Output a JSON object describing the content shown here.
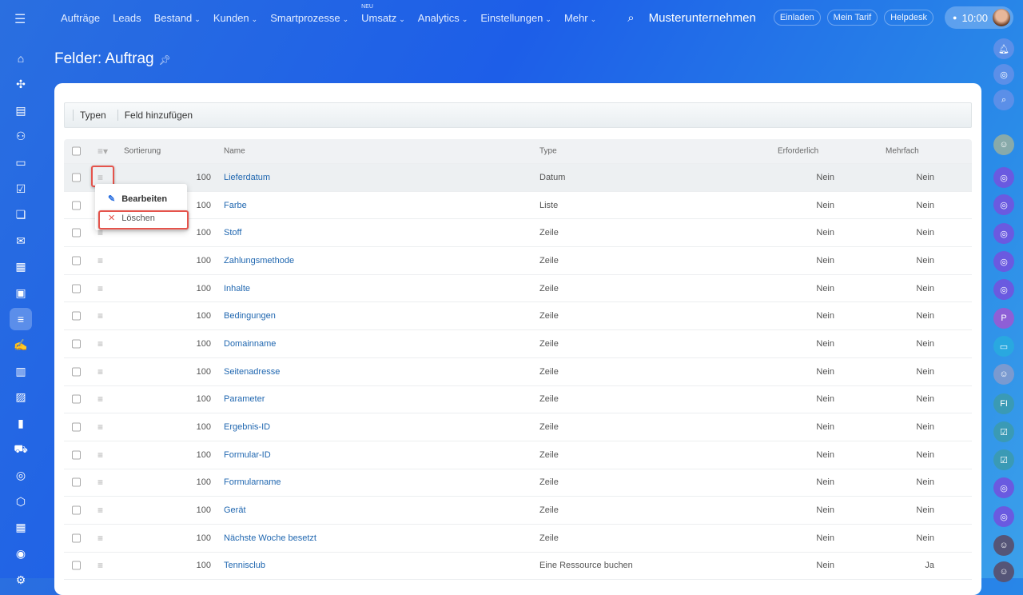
{
  "topbar": {
    "nav": [
      {
        "label": "Aufträge",
        "dropdown": false
      },
      {
        "label": "Leads",
        "dropdown": false
      },
      {
        "label": "Bestand",
        "dropdown": true
      },
      {
        "label": "Kunden",
        "dropdown": true
      },
      {
        "label": "Smartprozesse",
        "dropdown": true
      },
      {
        "label": "Umsatz",
        "dropdown": true,
        "badge": "NEU"
      },
      {
        "label": "Analytics",
        "dropdown": true
      },
      {
        "label": "Einstellungen",
        "dropdown": true
      },
      {
        "label": "Mehr",
        "dropdown": true
      }
    ],
    "company": "Musterunternehmen",
    "invite": "Einladen",
    "tariff": "Mein Tarif",
    "helpdesk": "Helpdesk",
    "time": "10:00"
  },
  "page": {
    "title": "Felder: Auftrag"
  },
  "toolbar": {
    "types": "Typen",
    "add_field": "Feld hinzufügen"
  },
  "table": {
    "headers": {
      "sort": "Sortierung",
      "name": "Name",
      "type": "Type",
      "required": "Erforderlich",
      "multiple": "Mehrfach"
    },
    "rows": [
      {
        "sort": "100",
        "name": "Lieferdatum",
        "type": "Datum",
        "required": "Nein",
        "multiple": "Nein"
      },
      {
        "sort": "100",
        "name": "Farbe",
        "type": "Liste",
        "required": "Nein",
        "multiple": "Nein"
      },
      {
        "sort": "100",
        "name": "Stoff",
        "type": "Zeile",
        "required": "Nein",
        "multiple": "Nein"
      },
      {
        "sort": "100",
        "name": "Zahlungsmethode",
        "type": "Zeile",
        "required": "Nein",
        "multiple": "Nein"
      },
      {
        "sort": "100",
        "name": "Inhalte",
        "type": "Zeile",
        "required": "Nein",
        "multiple": "Nein"
      },
      {
        "sort": "100",
        "name": "Bedingungen",
        "type": "Zeile",
        "required": "Nein",
        "multiple": "Nein"
      },
      {
        "sort": "100",
        "name": "Domainname",
        "type": "Zeile",
        "required": "Nein",
        "multiple": "Nein"
      },
      {
        "sort": "100",
        "name": "Seitenadresse",
        "type": "Zeile",
        "required": "Nein",
        "multiple": "Nein"
      },
      {
        "sort": "100",
        "name": "Parameter",
        "type": "Zeile",
        "required": "Nein",
        "multiple": "Nein"
      },
      {
        "sort": "100",
        "name": "Ergebnis-ID",
        "type": "Zeile",
        "required": "Nein",
        "multiple": "Nein"
      },
      {
        "sort": "100",
        "name": "Formular-ID",
        "type": "Zeile",
        "required": "Nein",
        "multiple": "Nein"
      },
      {
        "sort": "100",
        "name": "Formularname",
        "type": "Zeile",
        "required": "Nein",
        "multiple": "Nein"
      },
      {
        "sort": "100",
        "name": "Gerät",
        "type": "Zeile",
        "required": "Nein",
        "multiple": "Nein"
      },
      {
        "sort": "100",
        "name": "Nächste Woche besetzt",
        "type": "Zeile",
        "required": "Nein",
        "multiple": "Nein"
      },
      {
        "sort": "100",
        "name": "Tennisclub",
        "type": "Eine Ressource buchen",
        "required": "Nein",
        "multiple": "Ja"
      }
    ]
  },
  "context_menu": {
    "edit": "Bearbeiten",
    "delete": "Löschen"
  },
  "right_sidebar": {
    "initials_p": "P",
    "initials_fi": "FI"
  }
}
